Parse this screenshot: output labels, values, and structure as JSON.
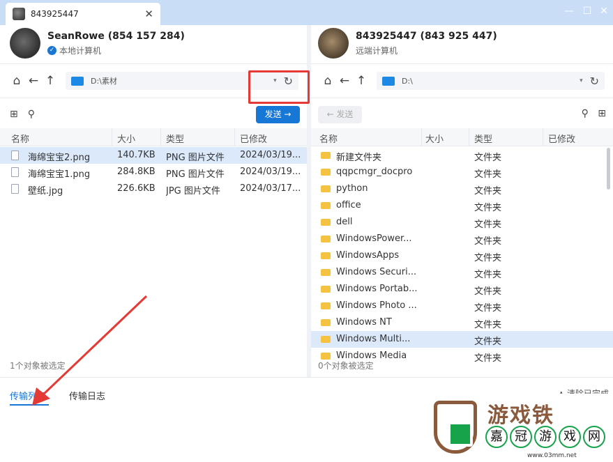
{
  "window": {
    "tab_title": "843925447",
    "tab_close": "✕",
    "btn_min": "—",
    "btn_max": "☐",
    "btn_close": "✕"
  },
  "left": {
    "user_name": "SeanRowe (854 157 284)",
    "user_sub": "本地计算机",
    "path": "D:\\素材",
    "send_label": "发送 →",
    "columns": [
      "名称",
      "大小",
      "类型",
      "已修改"
    ],
    "files": [
      {
        "name": "海绵宝宝2.png",
        "size": "140.7KB",
        "type": "PNG 图片文件",
        "modified": "2024/03/19..."
      },
      {
        "name": "海绵宝宝1.png",
        "size": "284.8KB",
        "type": "PNG 图片文件",
        "modified": "2024/03/19..."
      },
      {
        "name": "壁纸.jpg",
        "size": "226.6KB",
        "type": "JPG 图片文件",
        "modified": "2024/03/17..."
      }
    ],
    "status": "1个对象被选定"
  },
  "right": {
    "user_name": "843925447 (843 925 447)",
    "user_sub": "远端计算机",
    "path": "D:\\",
    "send_label": "← 发送",
    "columns": [
      "名称",
      "大小",
      "类型",
      "已修改"
    ],
    "files": [
      {
        "name": "新建文件夹",
        "type": "文件夹"
      },
      {
        "name": "qqpcmgr_docpro",
        "type": "文件夹"
      },
      {
        "name": "python",
        "type": "文件夹"
      },
      {
        "name": "office",
        "type": "文件夹"
      },
      {
        "name": "dell",
        "type": "文件夹"
      },
      {
        "name": "WindowsPower...",
        "type": "文件夹"
      },
      {
        "name": "WindowsApps",
        "type": "文件夹"
      },
      {
        "name": "Windows Securi...",
        "type": "文件夹"
      },
      {
        "name": "Windows Portab...",
        "type": "文件夹"
      },
      {
        "name": "Windows Photo ...",
        "type": "文件夹"
      },
      {
        "name": "Windows NT",
        "type": "文件夹"
      },
      {
        "name": "Windows Multi...",
        "type": "文件夹"
      },
      {
        "name": "Windows Media",
        "type": "文件夹"
      }
    ],
    "status": "0个对象被选定"
  },
  "bottom": {
    "tab_transfer": "传输列表",
    "tab_log": "传输日志",
    "clear_done": "∧ 清除已完成"
  },
  "watermark": {
    "title": "游戏铁",
    "chars": [
      "嘉",
      "冠",
      "游",
      "戏",
      "网"
    ],
    "url": "www.03mm.net"
  },
  "colors": {
    "accent": "#1677d6",
    "highlight_box": "#e53935",
    "folder": "#f5c242"
  }
}
